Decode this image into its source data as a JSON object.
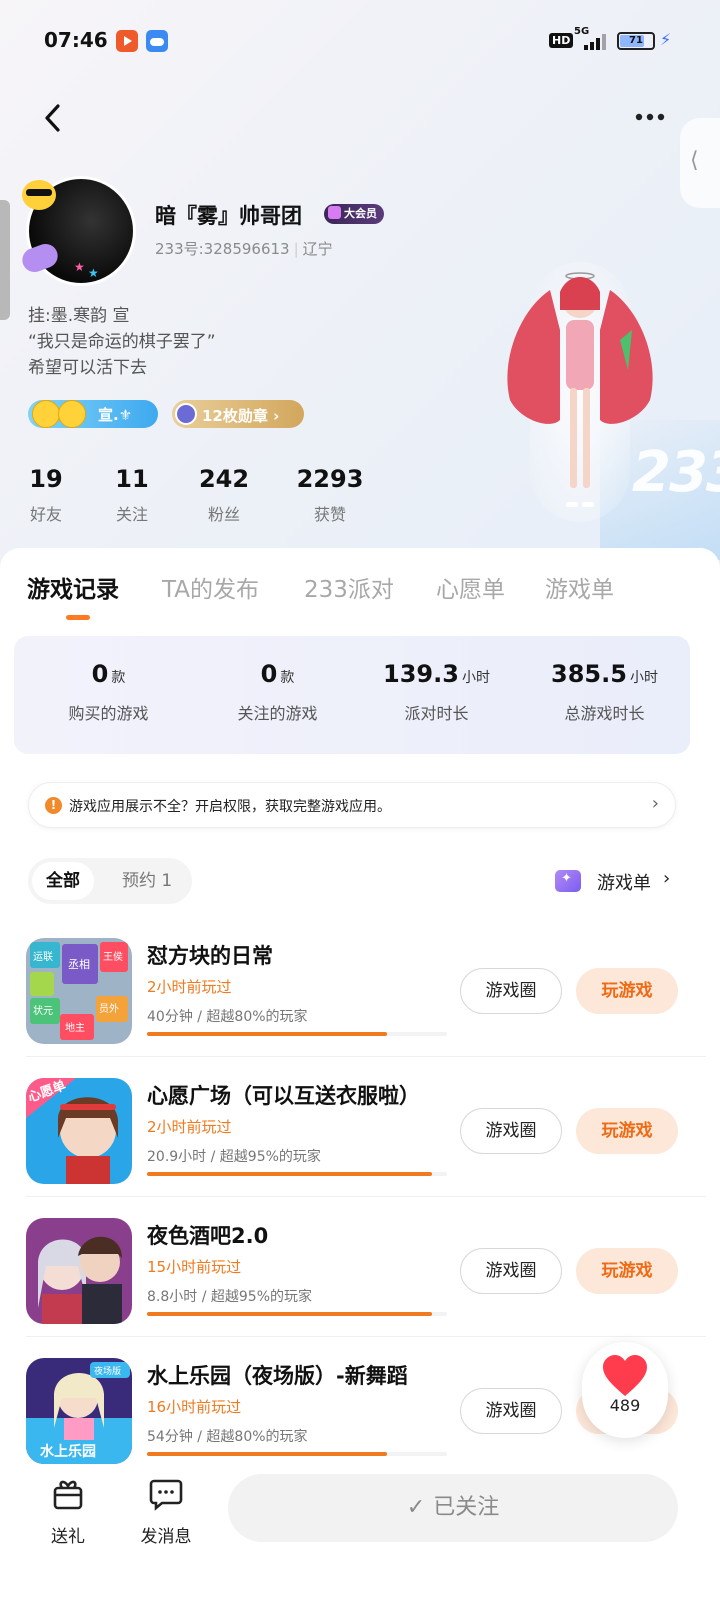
{
  "status_bar": {
    "time": "07:46",
    "hd": "HD",
    "network": "5G",
    "battery": "71"
  },
  "profile": {
    "name": "暗『雾』帅哥团",
    "vip_label": "大会员",
    "uid": "233号:328596613",
    "region": "辽宁",
    "bio": [
      "挂:墨.寒韵 宣",
      "“我只是命运的棋子罢了”",
      "希望可以活下去"
    ],
    "tag_name": "宣.⚜",
    "medals": "12枚勋章 ›"
  },
  "stats": [
    {
      "value": "19",
      "label": "好友"
    },
    {
      "value": "11",
      "label": "关注"
    },
    {
      "value": "242",
      "label": "粉丝"
    },
    {
      "value": "2293",
      "label": "获赞"
    }
  ],
  "hero_badge": "233",
  "tabs": [
    "游戏记录",
    "TA的发布",
    "233派对",
    "心愿单",
    "游戏单"
  ],
  "summary": [
    {
      "value": "0",
      "unit": "款",
      "label": "购买的游戏"
    },
    {
      "value": "0",
      "unit": "款",
      "label": "关注的游戏"
    },
    {
      "value": "139.3",
      "unit": "小时",
      "label": "派对时长"
    },
    {
      "value": "385.5",
      "unit": "小时",
      "label": "总游戏时长"
    }
  ],
  "notice": {
    "icon": "warning-icon",
    "text": "游戏应用展示不全？开启权限，获取完整游戏应用。"
  },
  "filter": {
    "all": "全部",
    "reserved": "预约 1"
  },
  "gamelist_link": "游戏单",
  "games": [
    {
      "title": "怼方块的日常",
      "played": "2小时前玩过",
      "stat": "40分钟 / 超越80%的玩家",
      "percent": 80,
      "circle": "游戏圈",
      "play": "玩游戏"
    },
    {
      "title": "心愿广场（可以互送衣服啦）",
      "played": "2小时前玩过",
      "stat": "20.9小时 / 超越95%的玩家",
      "percent": 95,
      "circle": "游戏圈",
      "play": "玩游戏"
    },
    {
      "title": "夜色酒吧2.0",
      "played": "15小时前玩过",
      "stat": "8.8小时 / 超越95%的玩家",
      "percent": 95,
      "circle": "游戏圈",
      "play": "玩游戏"
    },
    {
      "title": "水上乐园（夜场版）-新舞蹈",
      "played": "16小时前玩过",
      "stat": "54分钟 / 超越80%的玩家",
      "percent": 80,
      "circle": "游戏圈",
      "play": "玩游戏"
    }
  ],
  "thumb_texts": {
    "g1": [
      "运联",
      "丞相",
      "王侯",
      "状元",
      "员外",
      "地主"
    ],
    "g2": "心愿单",
    "g4": [
      "水上乐园",
      "夜场版"
    ]
  },
  "likes": "489",
  "bottom_bar": {
    "gift": "送礼",
    "message": "发消息",
    "followed": "已关注"
  },
  "colors": {
    "accent": "#f07a1f",
    "vip": "#3a2656"
  }
}
